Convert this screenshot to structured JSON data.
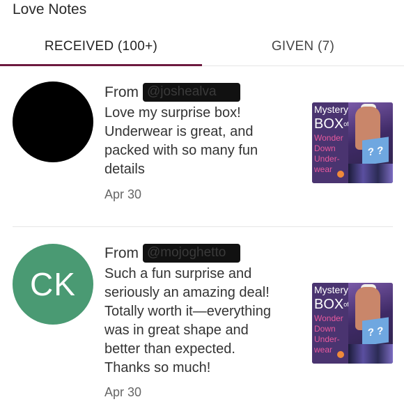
{
  "header": {
    "title": "Love Notes"
  },
  "tabs": [
    {
      "label": "RECEIVED (100+)",
      "active": true
    },
    {
      "label": "GIVEN (7)",
      "active": false
    }
  ],
  "accent_color": "#6d1a3f",
  "notes": [
    {
      "from_label": "From",
      "handle": "@joshealva",
      "avatar_initials": "",
      "avatar_color": "#000000",
      "message": "Love my surprise box!\nUnderwear is great, and\npacked with so many fun\ndetails",
      "date": "Apr 30",
      "product": {
        "line1": "Mystery",
        "line2": "BOX",
        "line2_sup": "of",
        "line3": "Wonder\nDown\nUnder-\nwear",
        "badge": "? ?"
      }
    },
    {
      "from_label": "From",
      "handle": "@mojoghetto",
      "avatar_initials": "CK",
      "avatar_color": "#4a9a73",
      "message": "Such a fun surprise and\nseriously an amazing deal!\nTotally worth it—everything\nwas in great shape and\nbetter than expected.\nThanks so much!",
      "date": "Apr 30",
      "product": {
        "line1": "Mystery",
        "line2": "BOX",
        "line2_sup": "of",
        "line3": "Wonder\nDown\nUnder-\nwear",
        "badge": "? ?"
      }
    }
  ]
}
